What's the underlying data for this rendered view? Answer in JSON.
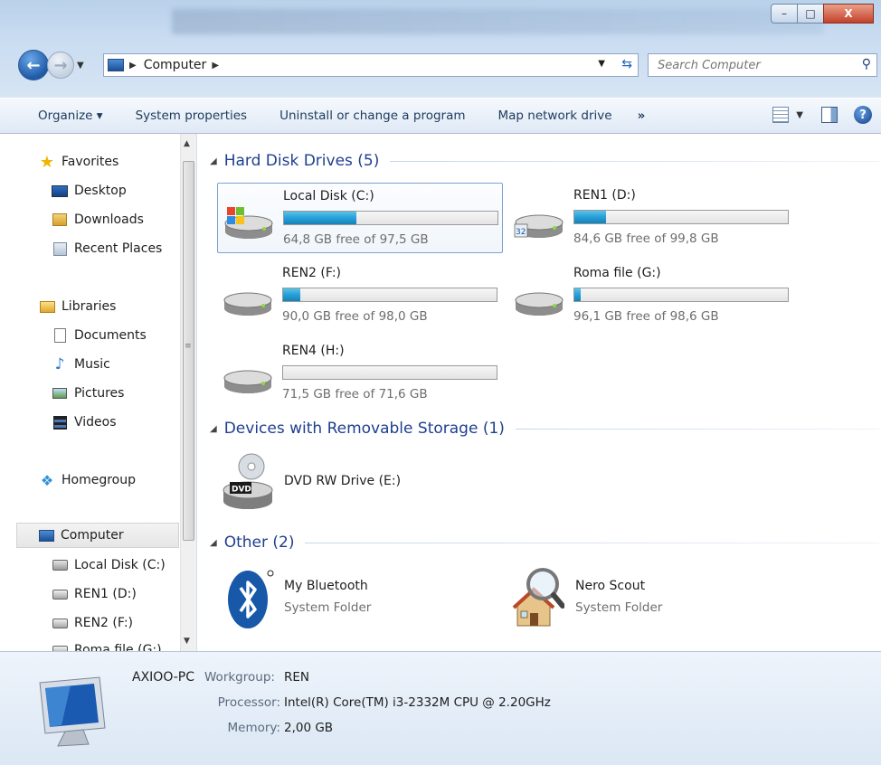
{
  "window": {
    "minimize_glyph": "–",
    "maximize_glyph": "□",
    "close_glyph": "X"
  },
  "address_bar": {
    "location": "Computer",
    "search_placeholder": "Search Computer"
  },
  "toolbar": {
    "organize": "Organize ▾",
    "system_properties": "System properties",
    "uninstall": "Uninstall or change a program",
    "map_drive": "Map network drive",
    "more": "»",
    "help": "?"
  },
  "nav": {
    "favorites": "Favorites",
    "desktop": "Desktop",
    "downloads": "Downloads",
    "recent_places": "Recent Places",
    "libraries": "Libraries",
    "documents": "Documents",
    "music": "Music",
    "pictures": "Pictures",
    "videos": "Videos",
    "homegroup": "Homegroup",
    "computer": "Computer",
    "local_disk_c": "Local Disk (C:)",
    "ren1_d": "REN1 (D:)",
    "ren2_f": "REN2 (F:)",
    "roma_g": "Roma file (G:)"
  },
  "groups": {
    "hard_disks": "Hard Disk Drives (5)",
    "removable": "Devices with Removable Storage (1)",
    "other": "Other (2)"
  },
  "drives": [
    {
      "name": "Local Disk (C:)",
      "free_text": "64,8 GB free of 97,5 GB",
      "used_fraction": 0.34
    },
    {
      "name": "REN1 (D:)",
      "free_text": "84,6 GB free of 99,8 GB",
      "used_fraction": 0.15
    },
    {
      "name": "REN2 (F:)",
      "free_text": "90,0 GB free of 98,0 GB",
      "used_fraction": 0.08
    },
    {
      "name": "Roma file (G:)",
      "free_text": "96,1 GB free of 98,6 GB",
      "used_fraction": 0.03
    },
    {
      "name": "REN4 (H:)",
      "free_text": "71,5 GB free of 71,6 GB",
      "used_fraction": 0.0
    }
  ],
  "removable": {
    "dvd": "DVD RW Drive (E:)",
    "dvd_badge": "DVD"
  },
  "other": {
    "bluetooth_name": "My Bluetooth",
    "bluetooth_type": "System Folder",
    "nero_name": "Nero Scout",
    "nero_type": "System Folder"
  },
  "details": {
    "pc_name": "AXIOO-PC",
    "workgroup_label": "Workgroup:",
    "workgroup_value": "REN",
    "processor_label": "Processor:",
    "processor_value": "Intel(R) Core(TM) i3-2332M CPU @ 2.20GHz",
    "memory_label": "Memory:",
    "memory_value": "2,00 GB"
  },
  "colors": {
    "accent_blue": "#1e3f8f",
    "bar_fill": "#26a0da"
  }
}
